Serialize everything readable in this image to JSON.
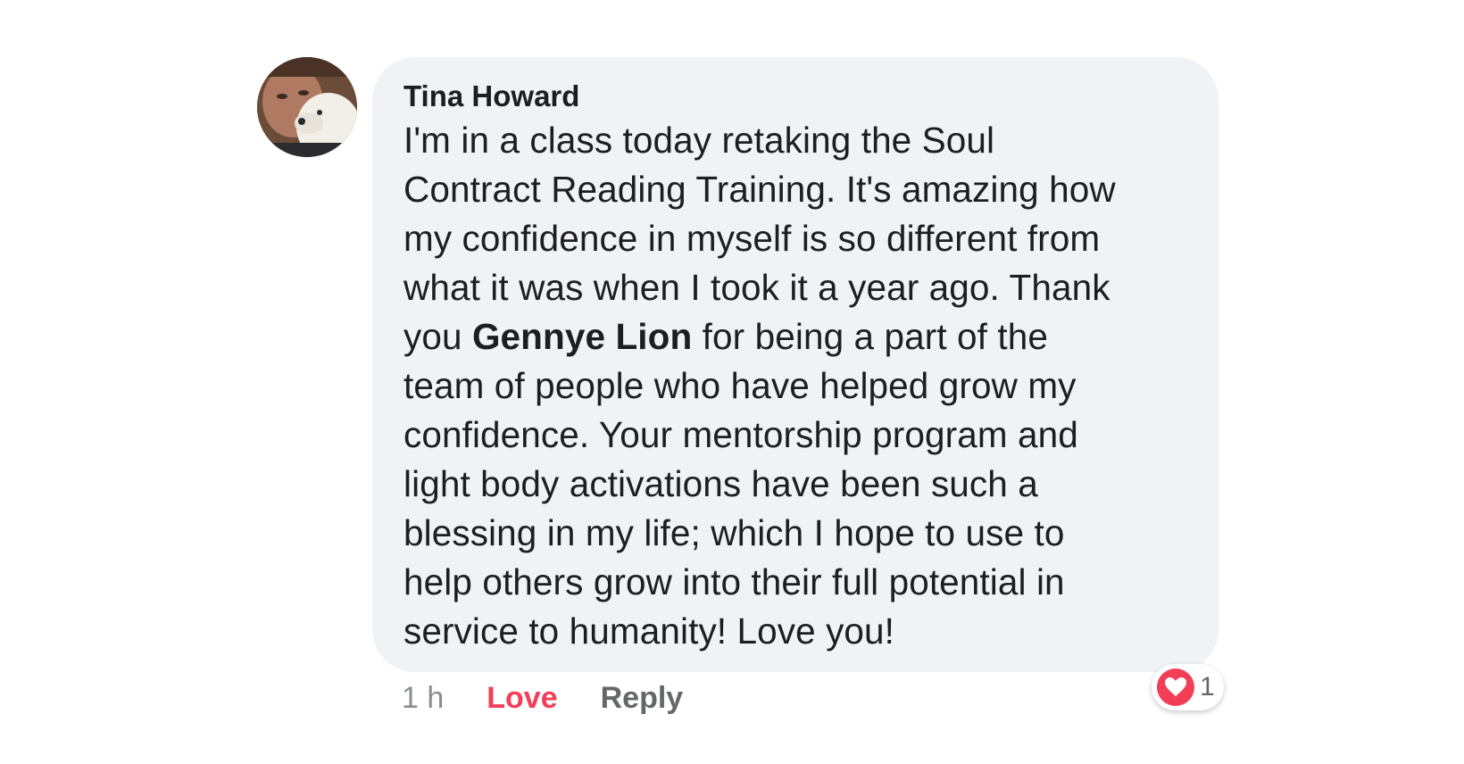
{
  "comment": {
    "author": "Tina Howard",
    "text_lines": [
      [
        "I'm in a class today retaking the Soul"
      ],
      [
        "Contract Reading Training. It's amazing how"
      ],
      [
        "my confidence in myself is so different from"
      ],
      [
        "what it was when I took it a year ago. Thank"
      ],
      [
        "you ",
        "Gennye Lion",
        " for being a part of the"
      ],
      [
        "team of people who have helped grow my"
      ],
      [
        "confidence. Your mentorship program and"
      ],
      [
        "light body activations have been such a"
      ],
      [
        "blessing in my life; which I hope to use to"
      ],
      [
        "help others grow into their full potential in"
      ],
      [
        "service to humanity! Love you!"
      ]
    ],
    "mention": "Gennye Lion",
    "timestamp": "1 h",
    "love_label": "Love",
    "reply_label": "Reply",
    "reaction": {
      "icon": "heart-icon",
      "count": "1",
      "color": "#f33e58"
    }
  },
  "colors": {
    "bubble_bg": "#f0f2f5",
    "love_active": "#f33e58",
    "muted": "#65676b"
  }
}
